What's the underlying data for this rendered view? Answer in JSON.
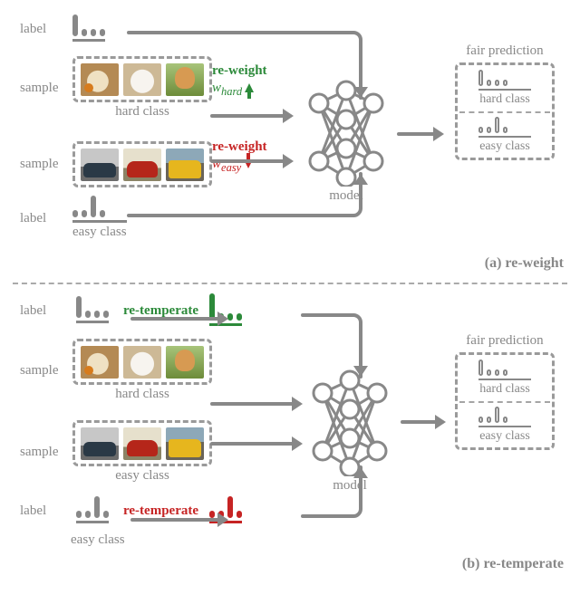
{
  "labels": {
    "label": "label",
    "sample": "sample",
    "hard_class": "hard class",
    "easy_class": "easy class",
    "model": "model",
    "fair_prediction": "fair prediction"
  },
  "panel_a": {
    "tag": "(a) re-weight",
    "reweight_hard": "re-weight",
    "w_hard": "w",
    "w_hard_sub": "hard",
    "reweight_easy": "re-weight",
    "w_easy": "w",
    "w_easy_sub": "easy"
  },
  "panel_b": {
    "tag": "(b) re-temperate",
    "retemp_hard": "re-temperate",
    "retemp_easy": "re-temperate"
  },
  "bars": {
    "hard_label": [
      "tall",
      "short",
      "short",
      "short"
    ],
    "easy_label": [
      "short",
      "short",
      "tall",
      "short"
    ],
    "hard_temp": [
      "tall",
      "short",
      "short",
      "short"
    ],
    "easy_temp": [
      "short",
      "short",
      "tall",
      "short"
    ],
    "pred_hard": [
      "tall",
      "short",
      "short",
      "short"
    ],
    "pred_easy": [
      "short",
      "short",
      "tall",
      "short"
    ]
  }
}
